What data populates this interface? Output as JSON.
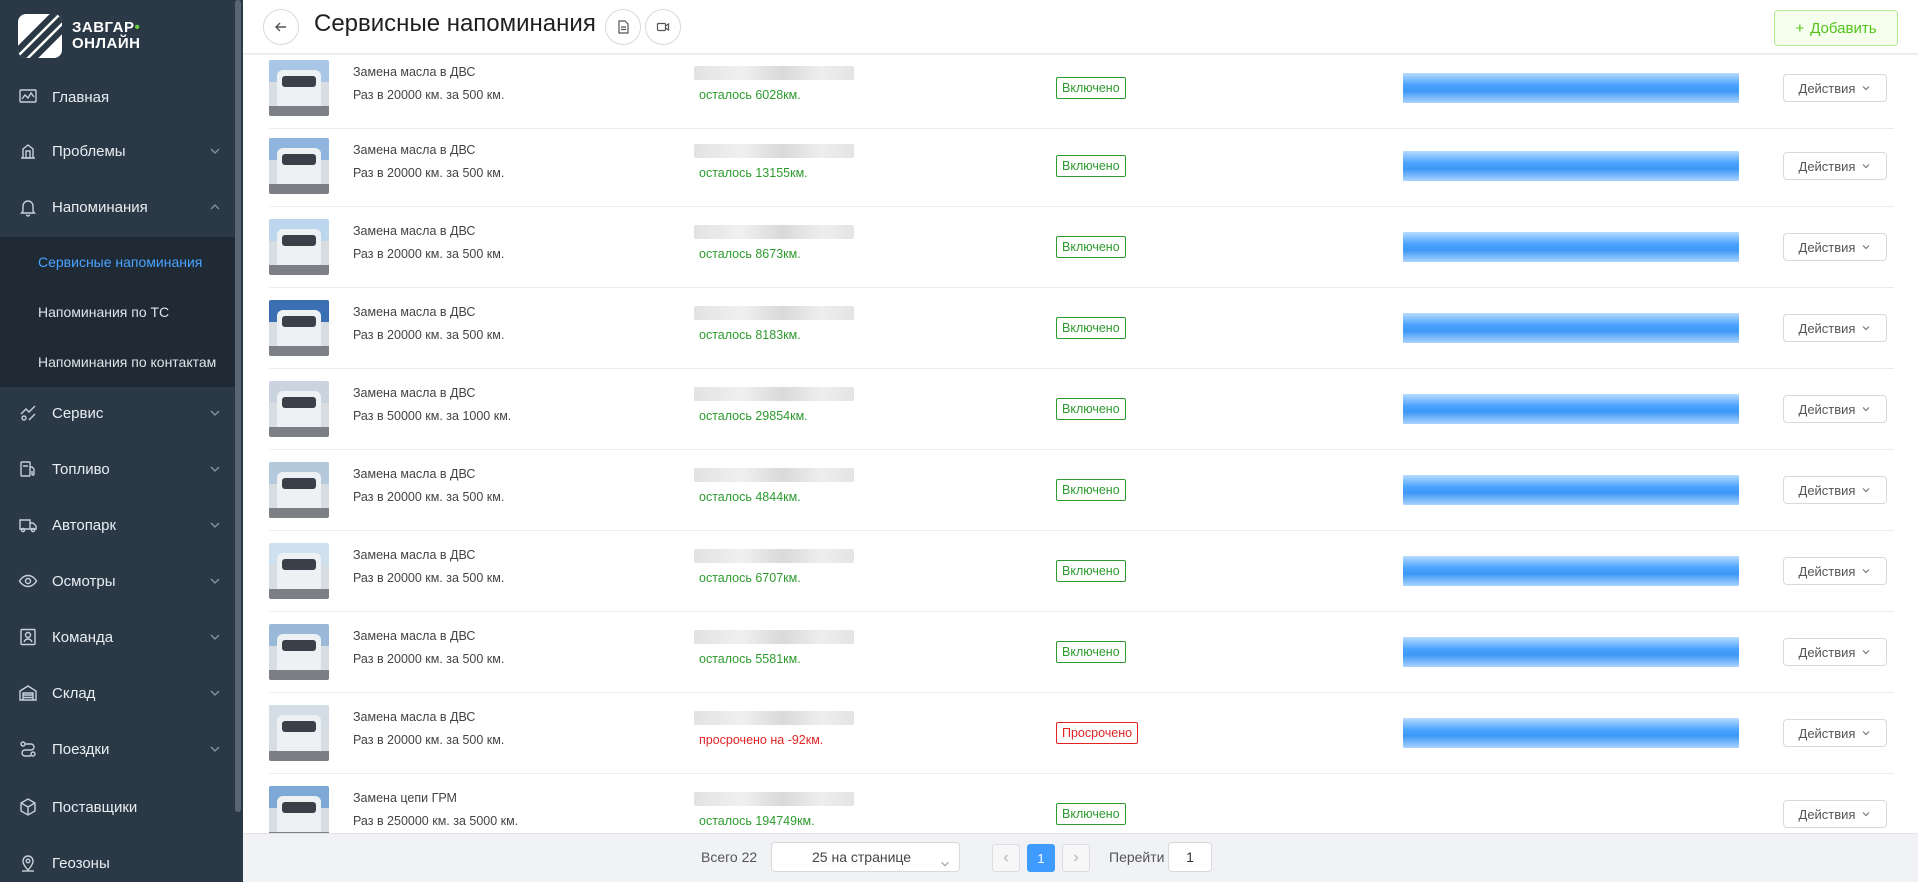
{
  "brand": {
    "line1": "ЗАВГАР",
    "line2": "ОНЛАЙН",
    "dot_color": "#6ccf3f"
  },
  "sidebar": {
    "items": [
      {
        "label": "Главная",
        "icon": "dashboard-icon"
      },
      {
        "label": "Проблемы",
        "icon": "wrench-icon"
      },
      {
        "label": "Напоминания",
        "icon": "bell-icon"
      },
      {
        "label": "Сервис",
        "icon": "service-icon"
      },
      {
        "label": "Топливо",
        "icon": "fuel-icon"
      },
      {
        "label": "Автопарк",
        "icon": "truck-icon"
      },
      {
        "label": "Осмотры",
        "icon": "eye-icon"
      },
      {
        "label": "Команда",
        "icon": "team-icon"
      },
      {
        "label": "Склад",
        "icon": "warehouse-icon"
      },
      {
        "label": "Поездки",
        "icon": "route-icon"
      },
      {
        "label": "Поставщики",
        "icon": "box-icon"
      },
      {
        "label": "Геозоны",
        "icon": "map-pin-icon"
      }
    ],
    "submenu": [
      {
        "label": "Сервисные напоминания",
        "active": true
      },
      {
        "label": "Напоминания по ТС",
        "active": false
      },
      {
        "label": "Напоминания по контактам",
        "active": false
      }
    ]
  },
  "header": {
    "title": "Сервисные напоминания",
    "add_label": "Добавить"
  },
  "rows": [
    {
      "task": "Замена масла в ДВС",
      "interval": "Раз в 20000 км. за 500 км.",
      "remain": "осталось 6028км.",
      "status": "Включено",
      "state": "ok",
      "action": "Действия"
    },
    {
      "task": "Замена масла в ДВС",
      "interval": "Раз в 20000 км. за 500 км.",
      "remain": "осталось 13155км.",
      "status": "Включено",
      "state": "ok",
      "action": "Действия"
    },
    {
      "task": "Замена масла в ДВС",
      "interval": "Раз в 20000 км. за 500 км.",
      "remain": "осталось 8673км.",
      "status": "Включено",
      "state": "ok",
      "action": "Действия"
    },
    {
      "task": "Замена масла в ДВС",
      "interval": "Раз в 20000 км. за 500 км.",
      "remain": "осталось 8183км.",
      "status": "Включено",
      "state": "ok",
      "action": "Действия"
    },
    {
      "task": "Замена масла в ДВС",
      "interval": "Раз в 50000 км. за 1000 км.",
      "remain": "осталось 29854км.",
      "status": "Включено",
      "state": "ok",
      "action": "Действия"
    },
    {
      "task": "Замена масла в ДВС",
      "interval": "Раз в 20000 км. за 500 км.",
      "remain": "осталось 4844км.",
      "status": "Включено",
      "state": "ok",
      "action": "Действия"
    },
    {
      "task": "Замена масла в ДВС",
      "interval": "Раз в 20000 км. за 500 км.",
      "remain": "осталось 6707км.",
      "status": "Включено",
      "state": "ok",
      "action": "Действия"
    },
    {
      "task": "Замена масла в ДВС",
      "interval": "Раз в 20000 км. за 500 км.",
      "remain": "осталось 5581км.",
      "status": "Включено",
      "state": "ok",
      "action": "Действия"
    },
    {
      "task": "Замена масла в ДВС",
      "interval": "Раз в 20000 км. за 500 км.",
      "remain": "просрочено на -92км.",
      "status": "Просрочено",
      "state": "bad",
      "action": "Действия"
    },
    {
      "task": "Замена цепи ГРМ",
      "interval": "Раз в 250000 км. за 5000 км.",
      "remain": "осталось 194749км.",
      "status": "Включено",
      "state": "ok",
      "action": "Действия"
    }
  ],
  "pagination": {
    "total": "Всего 22",
    "page_size": "25 на странице",
    "current": "1",
    "goto_label": "Перейти",
    "goto_value": "1"
  },
  "colors": {
    "accent": "#4aa3ff",
    "ok": "#2e9b2e",
    "bad": "#e02424",
    "sidebar_bg": "#2b3947"
  }
}
